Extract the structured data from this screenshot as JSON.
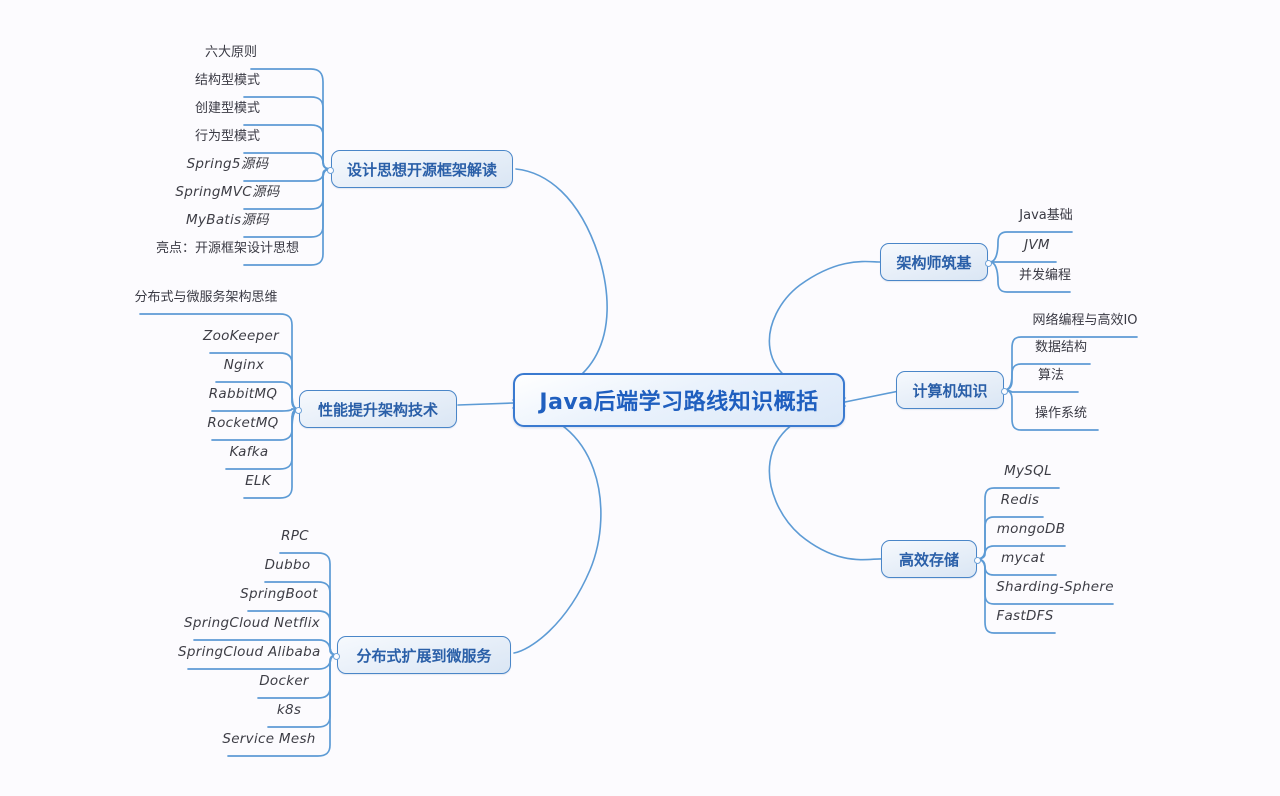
{
  "title": "Java后端学习路线知识概括",
  "theme": {
    "background": "#fcfbfe",
    "root_border": "#3a7ad0",
    "root_text": "#1f5fbf",
    "branch_border": "#4a86c8",
    "branch_text": "#2a5fa8",
    "link_color": "#5d9bd5",
    "leaf_text": "#3b3b42"
  },
  "root": {
    "label": "Java后端学习路线知识概括"
  },
  "branches": {
    "design": {
      "label": "设计思想开源框架解读",
      "side": "left",
      "leaves": [
        {
          "label": "六大原则"
        },
        {
          "label": "结构型模式"
        },
        {
          "label": "创建型模式"
        },
        {
          "label": "行为型模式"
        },
        {
          "label": "Spring5源码"
        },
        {
          "label": "SpringMVC源码"
        },
        {
          "label": "MyBatis源码"
        },
        {
          "label": "亮点：开源框架设计思想"
        }
      ]
    },
    "performance": {
      "label": "性能提升架构技术",
      "side": "left",
      "leaves": [
        {
          "label": "分布式与微服务架构思维"
        },
        {
          "label": "ZooKeeper"
        },
        {
          "label": "Nginx"
        },
        {
          "label": "RabbitMQ"
        },
        {
          "label": "RocketMQ"
        },
        {
          "label": "Kafka"
        },
        {
          "label": "ELK"
        }
      ]
    },
    "microservice": {
      "label": "分布式扩展到微服务",
      "side": "left",
      "leaves": [
        {
          "label": "RPC"
        },
        {
          "label": "Dubbo"
        },
        {
          "label": "SpringBoot"
        },
        {
          "label": "SpringCloud Netflix"
        },
        {
          "label": "SpringCloud Alibaba"
        },
        {
          "label": "Docker"
        },
        {
          "label": "k8s"
        },
        {
          "label": "Service Mesh"
        }
      ]
    },
    "foundation": {
      "label": "架构师筑基",
      "side": "right",
      "leaves": [
        {
          "label": "Java基础"
        },
        {
          "label": "JVM"
        },
        {
          "label": "并发编程"
        }
      ]
    },
    "computer": {
      "label": "计算机知识",
      "side": "right",
      "leaves": [
        {
          "label": "网络编程与高效IO"
        },
        {
          "label": "数据结构"
        },
        {
          "label": "算法"
        },
        {
          "label": "操作系统"
        }
      ]
    },
    "storage": {
      "label": "高效存储",
      "side": "right",
      "leaves": [
        {
          "label": "MySQL"
        },
        {
          "label": "Redis"
        },
        {
          "label": "mongoDB"
        },
        {
          "label": "mycat"
        },
        {
          "label": "Sharding-Sphere"
        },
        {
          "label": "FastDFS"
        }
      ]
    }
  }
}
